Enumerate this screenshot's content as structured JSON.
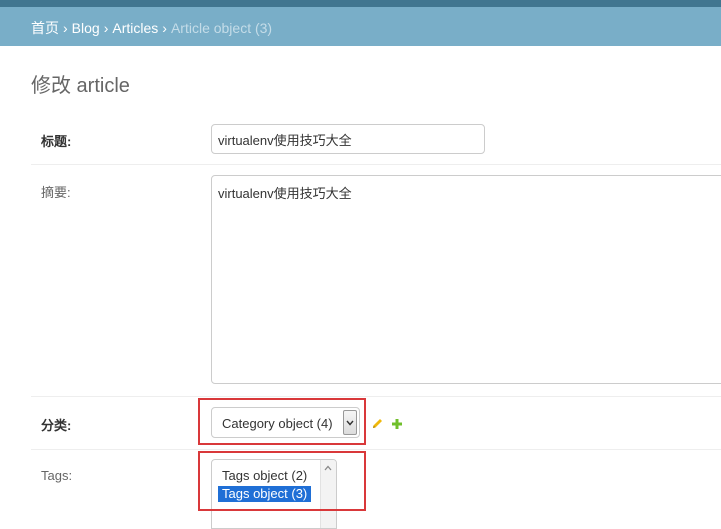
{
  "breadcrumb": {
    "home": "首页",
    "separator": "›",
    "app": "Blog",
    "model": "Articles",
    "current": "Article object (3)"
  },
  "page_title": "修改 article",
  "fields": {
    "title": {
      "label": "标题:",
      "value": "virtualenv使用技巧大全"
    },
    "summary": {
      "label": "摘要:",
      "value": "virtualenv使用技巧大全"
    },
    "category": {
      "label": "分类:",
      "selected": "Category object (4)"
    },
    "tags": {
      "label": "Tags:",
      "options": [
        "Tags object (2)",
        "Tags object (3)"
      ],
      "selected": "Tags object (3)"
    }
  },
  "icons": {
    "change": "pencil-icon",
    "add": "plus-icon"
  },
  "colors": {
    "header_dark": "#417690",
    "breadcrumb_bg": "#79aec8",
    "highlight": "#d9383a",
    "selected_option": "#1f6fd6",
    "add_icon": "#70bf2b",
    "change_icon": "#efb80b"
  }
}
